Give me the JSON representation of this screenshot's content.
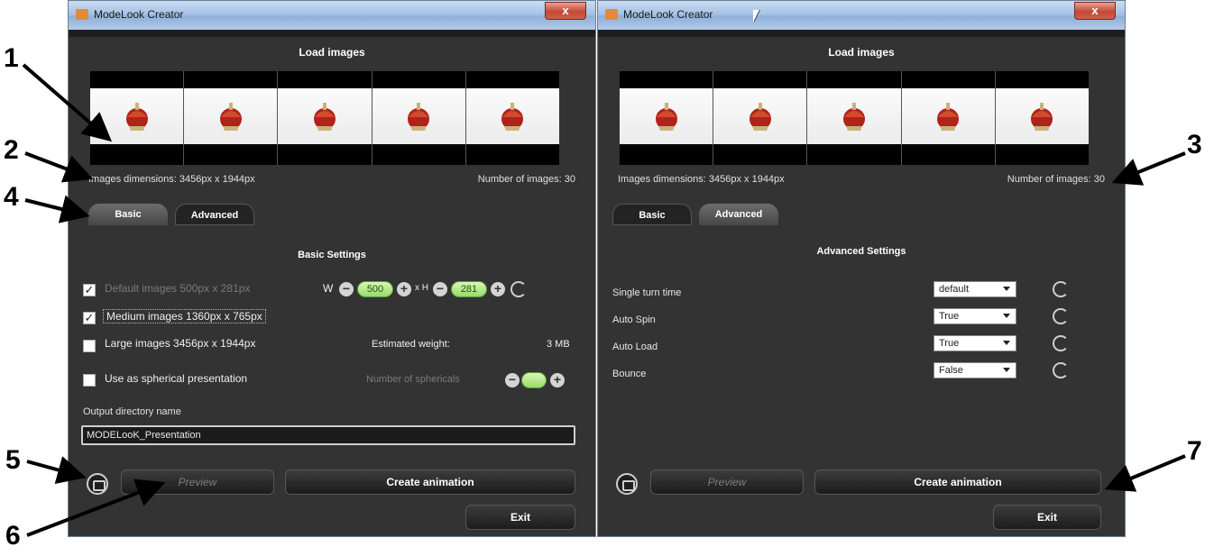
{
  "left_window": {
    "title": "ModeLook Creator",
    "close_label": "x",
    "load_title": "Load images",
    "image_dimensions": "Images dimensions: 3456px x 1944px",
    "image_count": "Number of images: 30",
    "tabs": [
      "Basic",
      "Advanced"
    ],
    "active_tab": "Basic",
    "section_title": "Basic Settings",
    "options": [
      {
        "label": "Default images 500px x 281px",
        "checked": true,
        "disabled": true
      },
      {
        "label": "Medium images 1360px x 765px",
        "checked": true,
        "disabled": false
      },
      {
        "label": "Large images 3456px x 1944px",
        "checked": false,
        "disabled": false
      },
      {
        "label": "Use as spherical presentation",
        "checked": false,
        "disabled": false
      }
    ],
    "width_label": "W",
    "width_value": "500",
    "height_label": "x H",
    "height_value": "281",
    "estimated_weight_label": "Estimated weight:",
    "estimated_weight_value": "3 MB",
    "spherical_label": "Number of sphericals",
    "output_label": "Output directory name",
    "output_value": "MODELooK_Presentation",
    "preview_label": "Preview",
    "create_label": "Create animation",
    "exit_label": "Exit"
  },
  "right_window": {
    "title": "ModeLook Creator",
    "close_label": "x",
    "load_title": "Load images",
    "image_dimensions": "Images dimensions: 3456px x 1944px",
    "image_count": "Number of images: 30",
    "tabs": [
      "Basic",
      "Advanced"
    ],
    "active_tab": "Advanced",
    "section_title": "Advanced Settings",
    "settings": [
      {
        "label": "Single turn time",
        "value": "default"
      },
      {
        "label": "Auto Spin",
        "value": "True"
      },
      {
        "label": "Auto Load",
        "value": "True"
      },
      {
        "label": "Bounce",
        "value": "False"
      }
    ],
    "preview_label": "Preview",
    "create_label": "Create animation",
    "exit_label": "Exit"
  },
  "callouts": [
    "1",
    "2",
    "3",
    "4",
    "5",
    "6",
    "7"
  ],
  "colors": {
    "window_bg": "#333333",
    "accent_green": "#98db6a",
    "title_bar": "#a7c3e6"
  }
}
